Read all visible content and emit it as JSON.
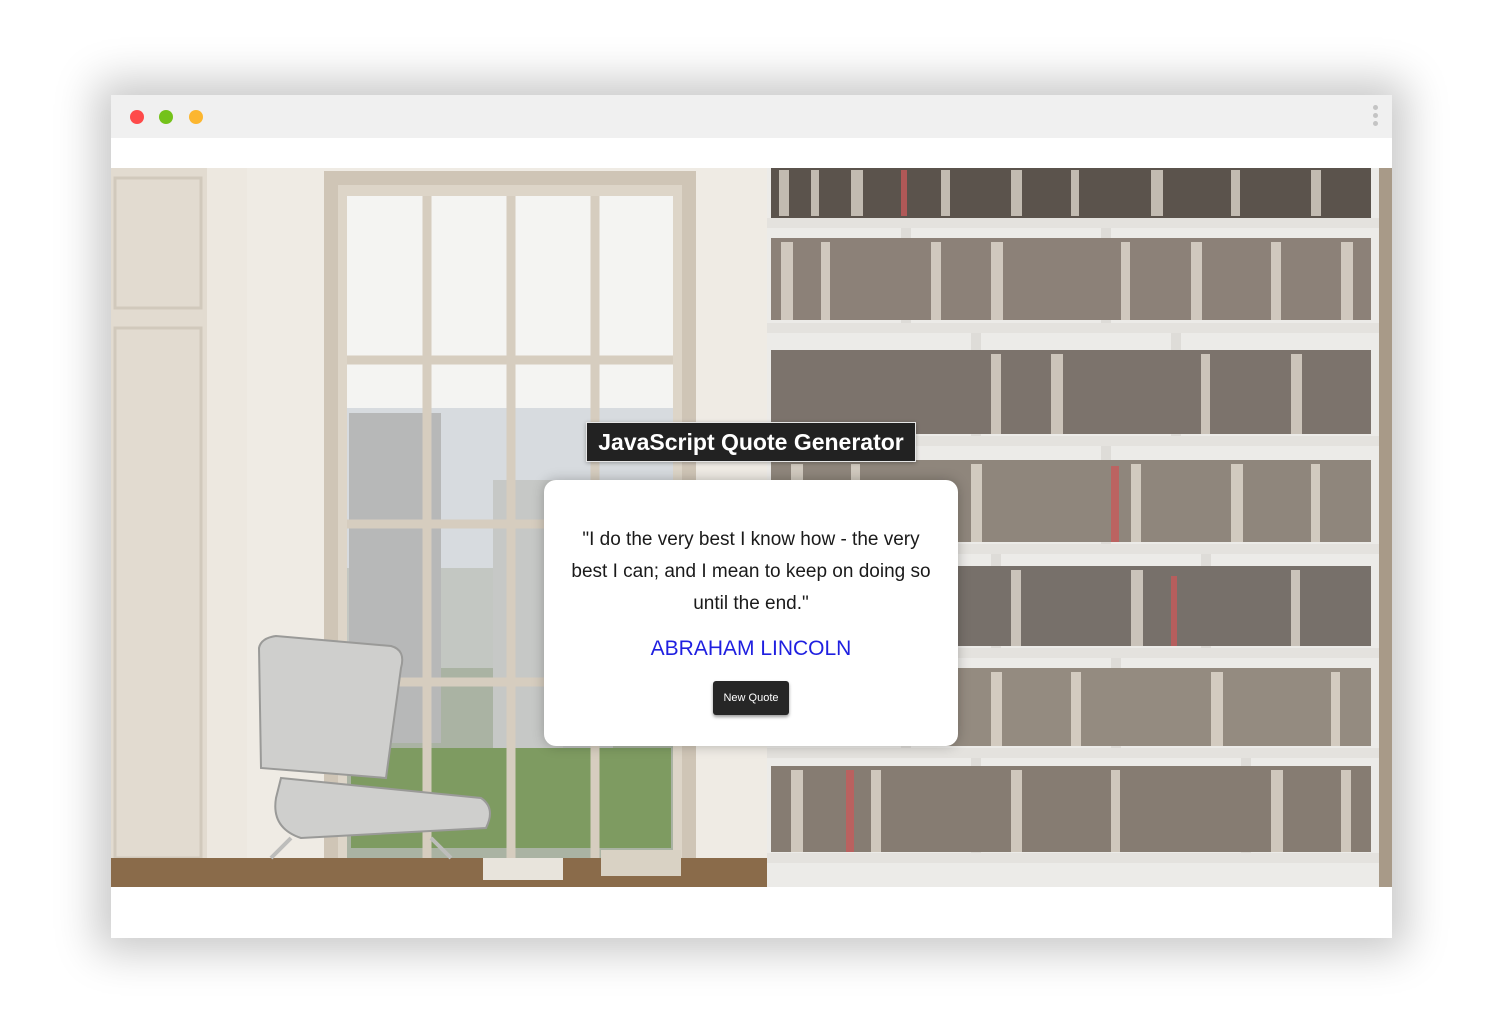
{
  "window": {
    "traffic_lights": [
      "close",
      "minimize",
      "zoom"
    ],
    "menu_icon": "kebab-menu-icon"
  },
  "background": {
    "description_icon": "library-room-photo"
  },
  "heading": "JavaScript Quote Generator",
  "quote": {
    "text": "\"I do the very best I know how - the very best I can; and I mean to keep on doing so until the end.\"",
    "author": "ABRAHAM LINCOLN",
    "author_color": "#1f1fe0"
  },
  "button": {
    "label": "New Quote"
  },
  "colors": {
    "heading_bg": "#222222",
    "button_bg": "#262626"
  }
}
